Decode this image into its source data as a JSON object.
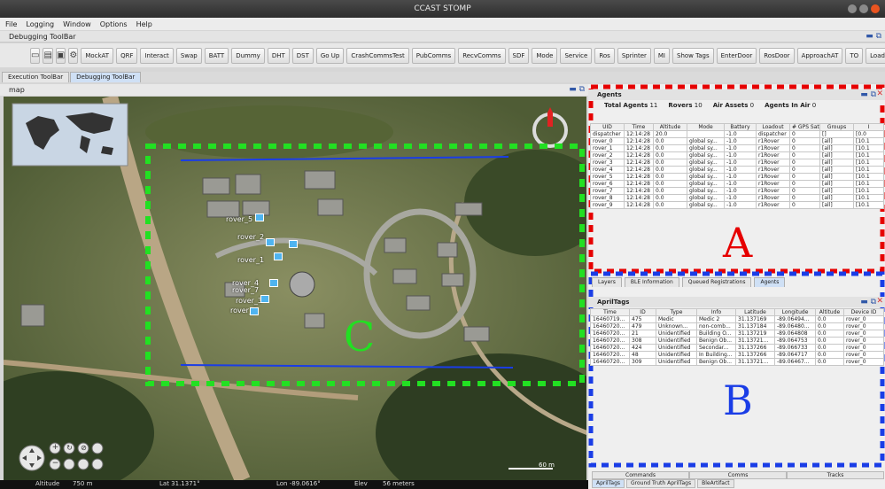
{
  "window": {
    "title": "CCAST STOMP"
  },
  "menu": [
    "File",
    "Logging",
    "Window",
    "Options",
    "Help"
  ],
  "debug_toolbar_title": "Debugging ToolBar",
  "toolbar_icons": [
    "page-icon",
    "file-icon",
    "save-icon",
    "robot-icon"
  ],
  "toolbar_buttons": [
    "MockAT",
    "QRF",
    "Interact",
    "Swap",
    "BATT",
    "Dummy",
    "DHT",
    "DST",
    "Go Up",
    "CrashCommsTest",
    "PubComms",
    "RecvComms",
    "SDF",
    "Mode",
    "Service",
    "Ros",
    "Sprinter",
    "MI",
    "Show Tags",
    "EnterDoor",
    "RosDoor",
    "ApproachAT",
    "TO",
    "Load Run"
  ],
  "top_tabs": [
    "Execution ToolBar",
    "Debugging ToolBar"
  ],
  "map_panel": {
    "title": "map"
  },
  "statusbar": {
    "altitude_label": "Altitude",
    "altitude": "750 m",
    "lat": "Lat 31.1371°",
    "lon": "Lon -89.0616°",
    "elev_label": "Elev",
    "elev": "56 meters"
  },
  "map_overlay": {
    "label_c": "C",
    "scale": "60 m"
  },
  "rovers": [
    "rover_5",
    "rover_1",
    "rover_3",
    "rover_9",
    "rover_2",
    "rover_4",
    "rover_7"
  ],
  "agents": {
    "title": "Agents",
    "total_agents_label": "Total Agents",
    "total_agents": "11",
    "rovers_label": "Rovers",
    "rovers": "10",
    "air_label": "Air Assets",
    "air": "0",
    "in_air_label": "Agents In Air",
    "in_air": "0",
    "columns": [
      "UID",
      "Time",
      "Altitude",
      "Mode",
      "Battery",
      "Loadout",
      "# GPS Sat",
      "Groups",
      "I"
    ],
    "rows": [
      [
        "dispatcher",
        "12:14:28",
        "20.0",
        "",
        "-1.0",
        "dispatcher",
        "0",
        "[]",
        "[0.0"
      ],
      [
        "rover_0",
        "12:14:28",
        "0.0",
        "global sy...",
        "-1.0",
        "r1Rover",
        "0",
        "[all]",
        "[10.1"
      ],
      [
        "rover_1",
        "12:14:28",
        "0.0",
        "global sy...",
        "-1.0",
        "r1Rover",
        "0",
        "[all]",
        "[10.1"
      ],
      [
        "rover_2",
        "12:14:28",
        "0.0",
        "global sy...",
        "-1.0",
        "r1Rover",
        "0",
        "[all]",
        "[10.1"
      ],
      [
        "rover_3",
        "12:14:28",
        "0.0",
        "global sy...",
        "-1.0",
        "r1Rover",
        "0",
        "[all]",
        "[10.1"
      ],
      [
        "rover_4",
        "12:14:28",
        "0.0",
        "global sy...",
        "-1.0",
        "r1Rover",
        "0",
        "[all]",
        "[10.1"
      ],
      [
        "rover_5",
        "12:14:28",
        "0.0",
        "global sy...",
        "-1.0",
        "r1Rover",
        "0",
        "[all]",
        "[10.1"
      ],
      [
        "rover_6",
        "12:14:28",
        "0.0",
        "global sy...",
        "-1.0",
        "r1Rover",
        "0",
        "[all]",
        "[10.1"
      ],
      [
        "rover_7",
        "12:14:28",
        "0.0",
        "global sy...",
        "-1.0",
        "r1Rover",
        "0",
        "[all]",
        "[10.1"
      ],
      [
        "rover_8",
        "12:14:28",
        "0.0",
        "global sy...",
        "-1.0",
        "r1Rover",
        "0",
        "[all]",
        "[10.1"
      ],
      [
        "rover_9",
        "12:14:28",
        "0.0",
        "global sy...",
        "-1.0",
        "r1Rover",
        "0",
        "[all]",
        "[10.1"
      ]
    ],
    "label": "A"
  },
  "mid_tabs": [
    "Layers",
    "BLE Information",
    "Queued Registrations",
    "Agents"
  ],
  "apriltags": {
    "title": "AprilTags",
    "columns": [
      "Time",
      "ID",
      "Type",
      "Info",
      "Latitude",
      "Longitude",
      "Altitude",
      "Device ID"
    ],
    "rows": [
      [
        "16460719...",
        "475",
        "Medic",
        "Medic 2",
        "31.137169",
        "-89.06494...",
        "0.0",
        "rover_0"
      ],
      [
        "16460720...",
        "479",
        "Unknown...",
        "non-comb...",
        "31.137184",
        "-89.06480...",
        "0.0",
        "rover_0"
      ],
      [
        "16460720...",
        "21",
        "Unidentified",
        "Building O...",
        "31.137219",
        "-89.064808",
        "0.0",
        "rover_0"
      ],
      [
        "16460720...",
        "308",
        "Unidentified",
        "Benign Ob...",
        "31.13721...",
        "-89.064753",
        "0.0",
        "rover_0"
      ],
      [
        "16460720...",
        "424",
        "Unidentified",
        "Secondar...",
        "31.137266",
        "-89.066733",
        "0.0",
        "rover_0"
      ],
      [
        "16460720...",
        "48",
        "Unidentified",
        "In Building...",
        "31.137266",
        "-89.064717",
        "0.0",
        "rover_0"
      ],
      [
        "16460720...",
        "309",
        "Unidentified",
        "Benign Ob...",
        "31.13721...",
        "-89.06467...",
        "0.0",
        "rover_0"
      ]
    ],
    "label": "B"
  },
  "bottom_tabs_row1": [
    "Commands",
    "Comms",
    "Tracks"
  ],
  "bottom_tabs_row2": [
    "AprilTags",
    "Ground Truth AprilTags",
    "BleArtifact"
  ],
  "colors": {
    "annot_red": "#e60000",
    "annot_blue": "#1a3de6",
    "annot_green": "#22e022",
    "rover_icon": "#4fb4f0"
  }
}
